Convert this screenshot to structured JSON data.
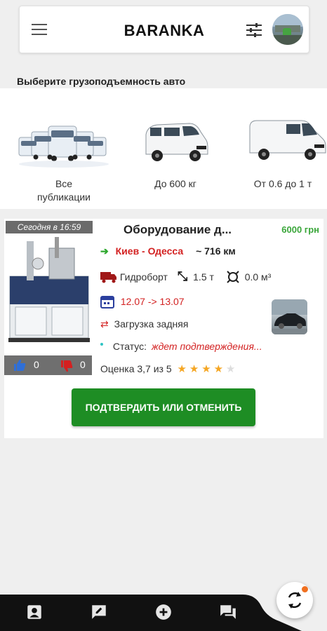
{
  "header": {
    "title": "BARANKA",
    "menu_icon": "menu-icon",
    "filter_icon": "sliders-icon",
    "avatar_icon": "avatar"
  },
  "section_label": "Выберите грузоподъемность авто",
  "categories": [
    {
      "label": "Все публикации",
      "icon": "truck-fleet-image"
    },
    {
      "label": "До 600 кг",
      "icon": "small-van-image"
    },
    {
      "label": "От 0.6 до 1 т",
      "icon": "van-image"
    }
  ],
  "card": {
    "time": "Сегодня в 16:59",
    "title": "Оборудование д...",
    "price": "6000 грн",
    "route": "Киев - Одесса",
    "distance": "~ 716 км",
    "body_type": "Гидроборт",
    "weight": "1.5 т",
    "volume": "0.0 м³",
    "dates": "12.07 -> 13.07",
    "loading": "Загрузка задняя",
    "status_label": "Статус:",
    "status_value": "ждет подтверждения...",
    "rating_text": "Оценка 3,7 из 5",
    "rating_value": 3.7,
    "likes": "0",
    "dislikes": "0",
    "confirm_label": "ПОДТВЕРДИТЬ ИЛИ ОТМЕНИТЬ"
  },
  "bottom_nav": [
    "contact-icon",
    "edit-message-icon",
    "add-circle-icon",
    "chat-icon"
  ],
  "fab_icon": "sync-icon",
  "colors": {
    "accent_green": "#1e8d24",
    "price_green": "#3aa63a",
    "route_red": "#d32222",
    "star_orange": "#f5a623",
    "nav_black": "#111111",
    "fab_dot": "#f07020"
  }
}
